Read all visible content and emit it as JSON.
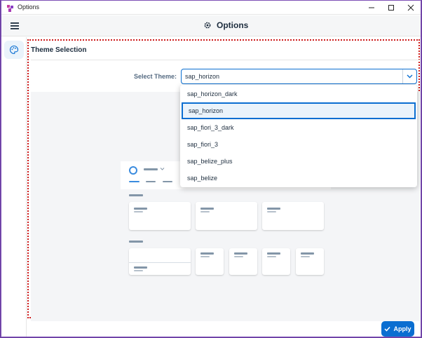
{
  "window": {
    "title": "Options",
    "controls": [
      "minimize-icon",
      "maximize-icon",
      "close-icon"
    ]
  },
  "header": {
    "title": "Options",
    "menu_icon": "hamburger-icon",
    "title_icon": "gear-icon"
  },
  "sidenav": {
    "items": [
      {
        "icon": "palette-icon",
        "selected": true
      }
    ]
  },
  "section": {
    "title": "Theme Selection"
  },
  "theme_select": {
    "label": "Select Theme:",
    "value": "sap_horizon",
    "options": [
      {
        "label": "sap_horizon_dark",
        "selected": false
      },
      {
        "label": "sap_horizon",
        "selected": true
      },
      {
        "label": "sap_fiori_3_dark",
        "selected": false
      },
      {
        "label": "sap_fiori_3",
        "selected": false
      },
      {
        "label": "sap_belize_plus",
        "selected": false
      },
      {
        "label": "sap_belize",
        "selected": false
      }
    ]
  },
  "footer": {
    "apply_label": "Apply"
  },
  "colors": {
    "accent": "#0a6ed1",
    "highlight": "#cc1a1a",
    "window_border": "#7d4fb5",
    "preview_background": "#f4f5f7"
  }
}
